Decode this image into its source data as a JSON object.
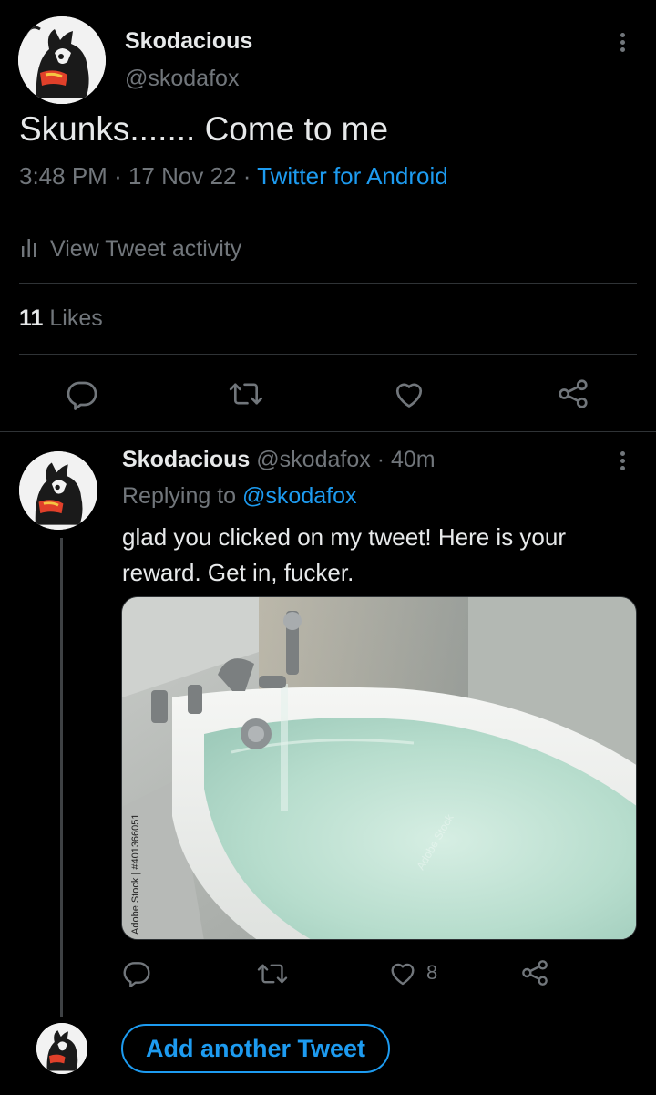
{
  "main_tweet": {
    "display_name": "Skodacious",
    "handle": "@skodafox",
    "text": "Skunks....... Come to me",
    "time": "3:48 PM",
    "sep1": "·",
    "date": "17 Nov 22",
    "sep2": "·",
    "source": "Twitter for Android",
    "activity_label": "View Tweet activity",
    "likes_count": "11",
    "likes_label": "Likes"
  },
  "reply": {
    "display_name": "Skodacious",
    "handle": "@skodafox",
    "sep": "·",
    "age": "40m",
    "replying_prefix": "Replying to",
    "replying_to": "@skodafox",
    "text": "glad you clicked on my tweet! Here is your reward. Get in, fucker.",
    "watermark_side": "Adobe Stock | #401366051",
    "watermark_diag": "Adobe Stock",
    "like_count": "8"
  },
  "composer": {
    "add_button_label": "Add another Tweet"
  },
  "colors": {
    "accent": "#1d9bf0",
    "muted": "#71767b",
    "divider": "#2f3336"
  },
  "icons": [
    "more-icon",
    "bar-chart-icon",
    "reply-icon",
    "retweet-icon",
    "heart-icon",
    "share-icon"
  ]
}
